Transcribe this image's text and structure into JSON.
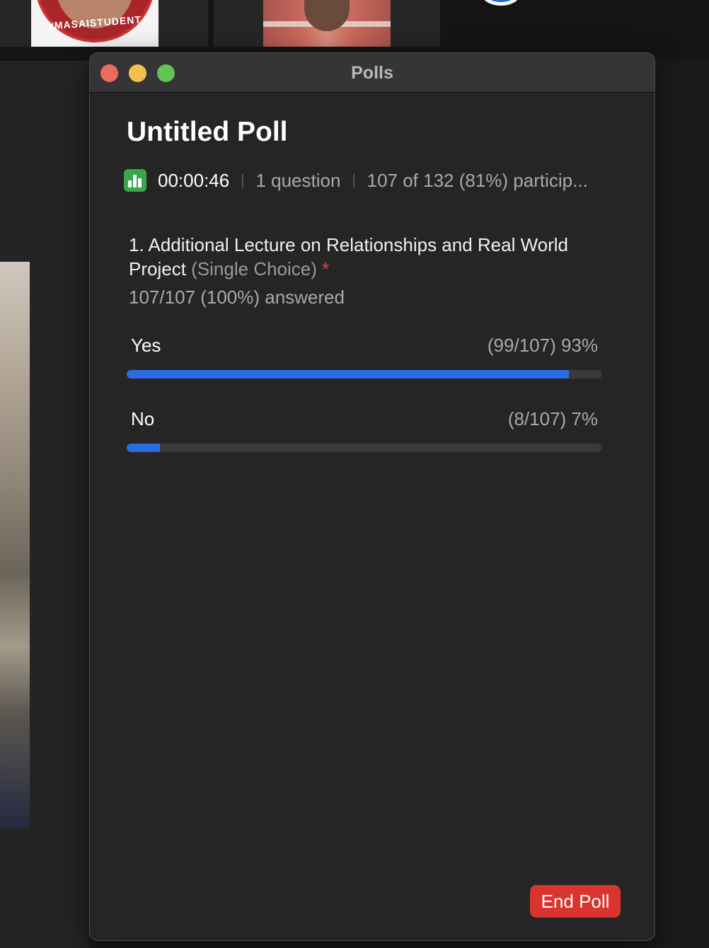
{
  "background": {
    "tiles": [
      {
        "badge_text": "#MASAISTUDENT"
      },
      {}
    ]
  },
  "window": {
    "title": "Polls"
  },
  "poll": {
    "title": "Untitled Poll",
    "timer": "00:00:46",
    "question_count": "1 question",
    "participation": "107 of 132 (81%) particip...",
    "question": {
      "text": "1. Additional Lecture on Relationships and Real World Project",
      "type": "(Single Choice)",
      "required_marker": "*",
      "answered": "107/107 (100%) answered"
    },
    "options": [
      {
        "label": "Yes",
        "stat": "(99/107) 93%",
        "fraction": 0.93
      },
      {
        "label": "No",
        "stat": "(8/107) 7%",
        "fraction": 0.07
      }
    ],
    "end_button": "End Poll"
  },
  "colors": {
    "bar_fill": "#2b6ce2",
    "end_button": "#d9352e",
    "poll_icon": "#3aa64c"
  },
  "icons": {
    "poll": "bar-chart-icon"
  }
}
